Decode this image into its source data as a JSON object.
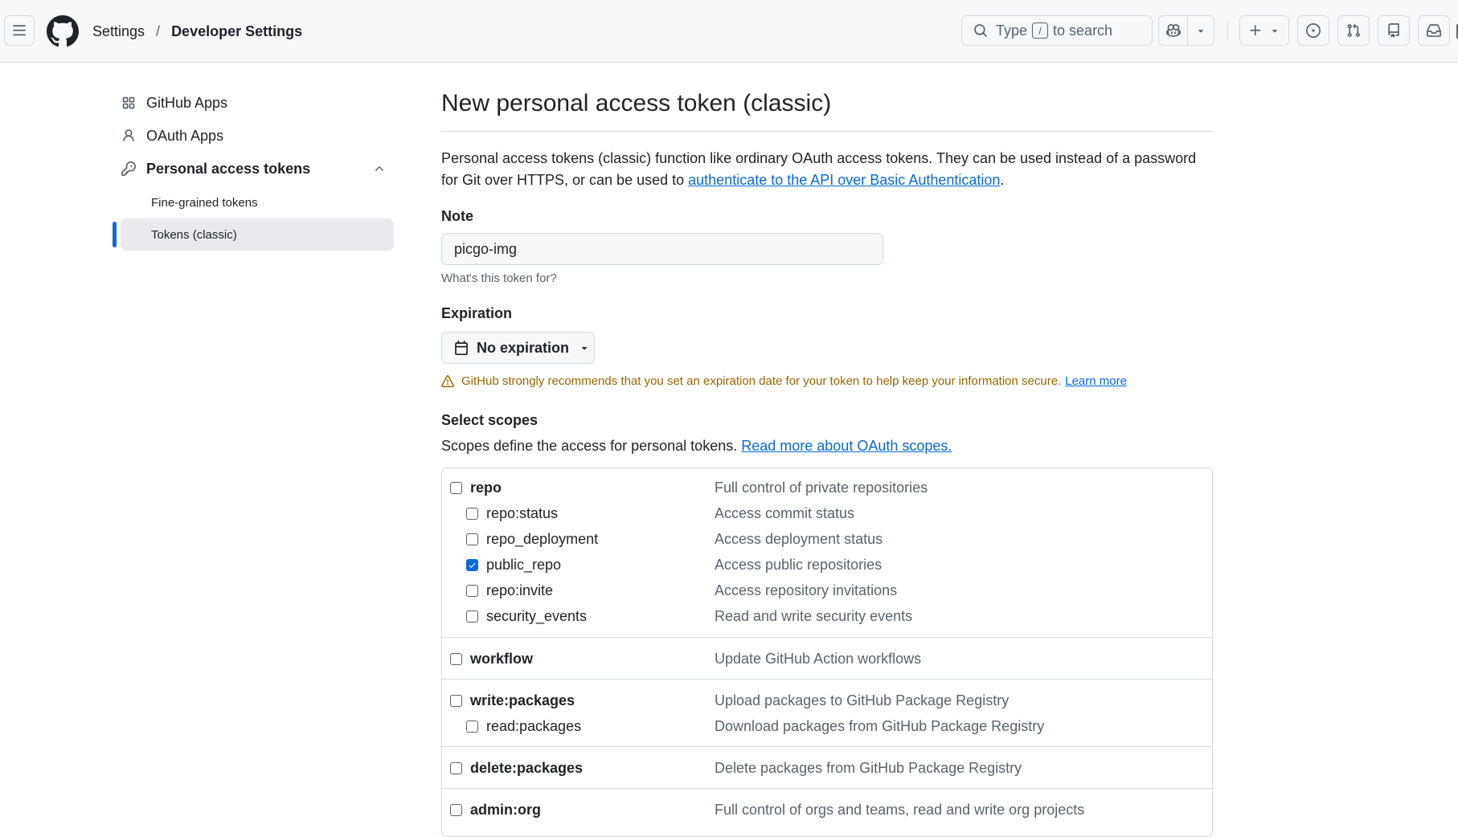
{
  "header": {
    "breadcrumb_parent": "Settings",
    "breadcrumb_separator": "/",
    "breadcrumb_current": "Developer Settings",
    "search_prefix": "Type",
    "search_key": "/",
    "search_suffix": "to search"
  },
  "sidebar": {
    "github_apps": "GitHub Apps",
    "oauth_apps": "OAuth Apps",
    "personal_access_tokens": "Personal access tokens",
    "fine_grained_tokens": "Fine-grained tokens",
    "tokens_classic": "Tokens (classic)"
  },
  "main": {
    "title": "New personal access token (classic)",
    "intro_text": "Personal access tokens (classic) function like ordinary OAuth access tokens. They can be used instead of a password for Git over HTTPS, or can be used to",
    "intro_link": "authenticate to the API over Basic Authentication",
    "intro_end": ".",
    "note_label": "Note",
    "note_value": "picgo-img",
    "note_hint": "What's this token for?",
    "expiration_label": "Expiration",
    "expiration_value": "No expiration",
    "warning_text": "GitHub strongly recommends that you set an expiration date for your token to help keep your information secure.",
    "warning_link": "Learn more",
    "scopes_label": "Select scopes",
    "scopes_text": "Scopes define the access for personal tokens.",
    "scopes_link": "Read more about OAuth scopes."
  },
  "scopes": {
    "repo": {
      "name": "repo",
      "desc": "Full control of private repositories",
      "checked": false
    },
    "repo_status": {
      "name": "repo:status",
      "desc": "Access commit status",
      "checked": false
    },
    "repo_deployment": {
      "name": "repo_deployment",
      "desc": "Access deployment status",
      "checked": false
    },
    "public_repo": {
      "name": "public_repo",
      "desc": "Access public repositories",
      "checked": true
    },
    "repo_invite": {
      "name": "repo:invite",
      "desc": "Access repository invitations",
      "checked": false
    },
    "security_events": {
      "name": "security_events",
      "desc": "Read and write security events",
      "checked": false
    },
    "workflow": {
      "name": "workflow",
      "desc": "Update GitHub Action workflows",
      "checked": false
    },
    "write_packages": {
      "name": "write:packages",
      "desc": "Upload packages to GitHub Package Registry",
      "checked": false
    },
    "read_packages": {
      "name": "read:packages",
      "desc": "Download packages from GitHub Package Registry",
      "checked": false
    },
    "delete_packages": {
      "name": "delete:packages",
      "desc": "Delete packages from GitHub Package Registry",
      "checked": false
    },
    "admin_org": {
      "name": "admin:org",
      "desc": "Full control of orgs and teams, read and write org projects",
      "checked": false
    }
  },
  "icons": {
    "menu": "hamburger-icon",
    "logo": "github-logo-icon",
    "search": "search-icon",
    "copilot": "copilot-icon",
    "create": "plus-icon",
    "issues": "issue-opened-icon",
    "pulls": "git-pull-request-icon",
    "repos": "repo-icon",
    "inbox": "inbox-icon",
    "apps": "apps-icon",
    "oauth": "person-icon",
    "key": "key-icon",
    "calendar": "calendar-icon",
    "alert": "alert-icon"
  },
  "colors": {
    "accent": "#0969da",
    "warning": "#9a6700",
    "muted": "#59636e",
    "border": "#d1d9e0"
  }
}
